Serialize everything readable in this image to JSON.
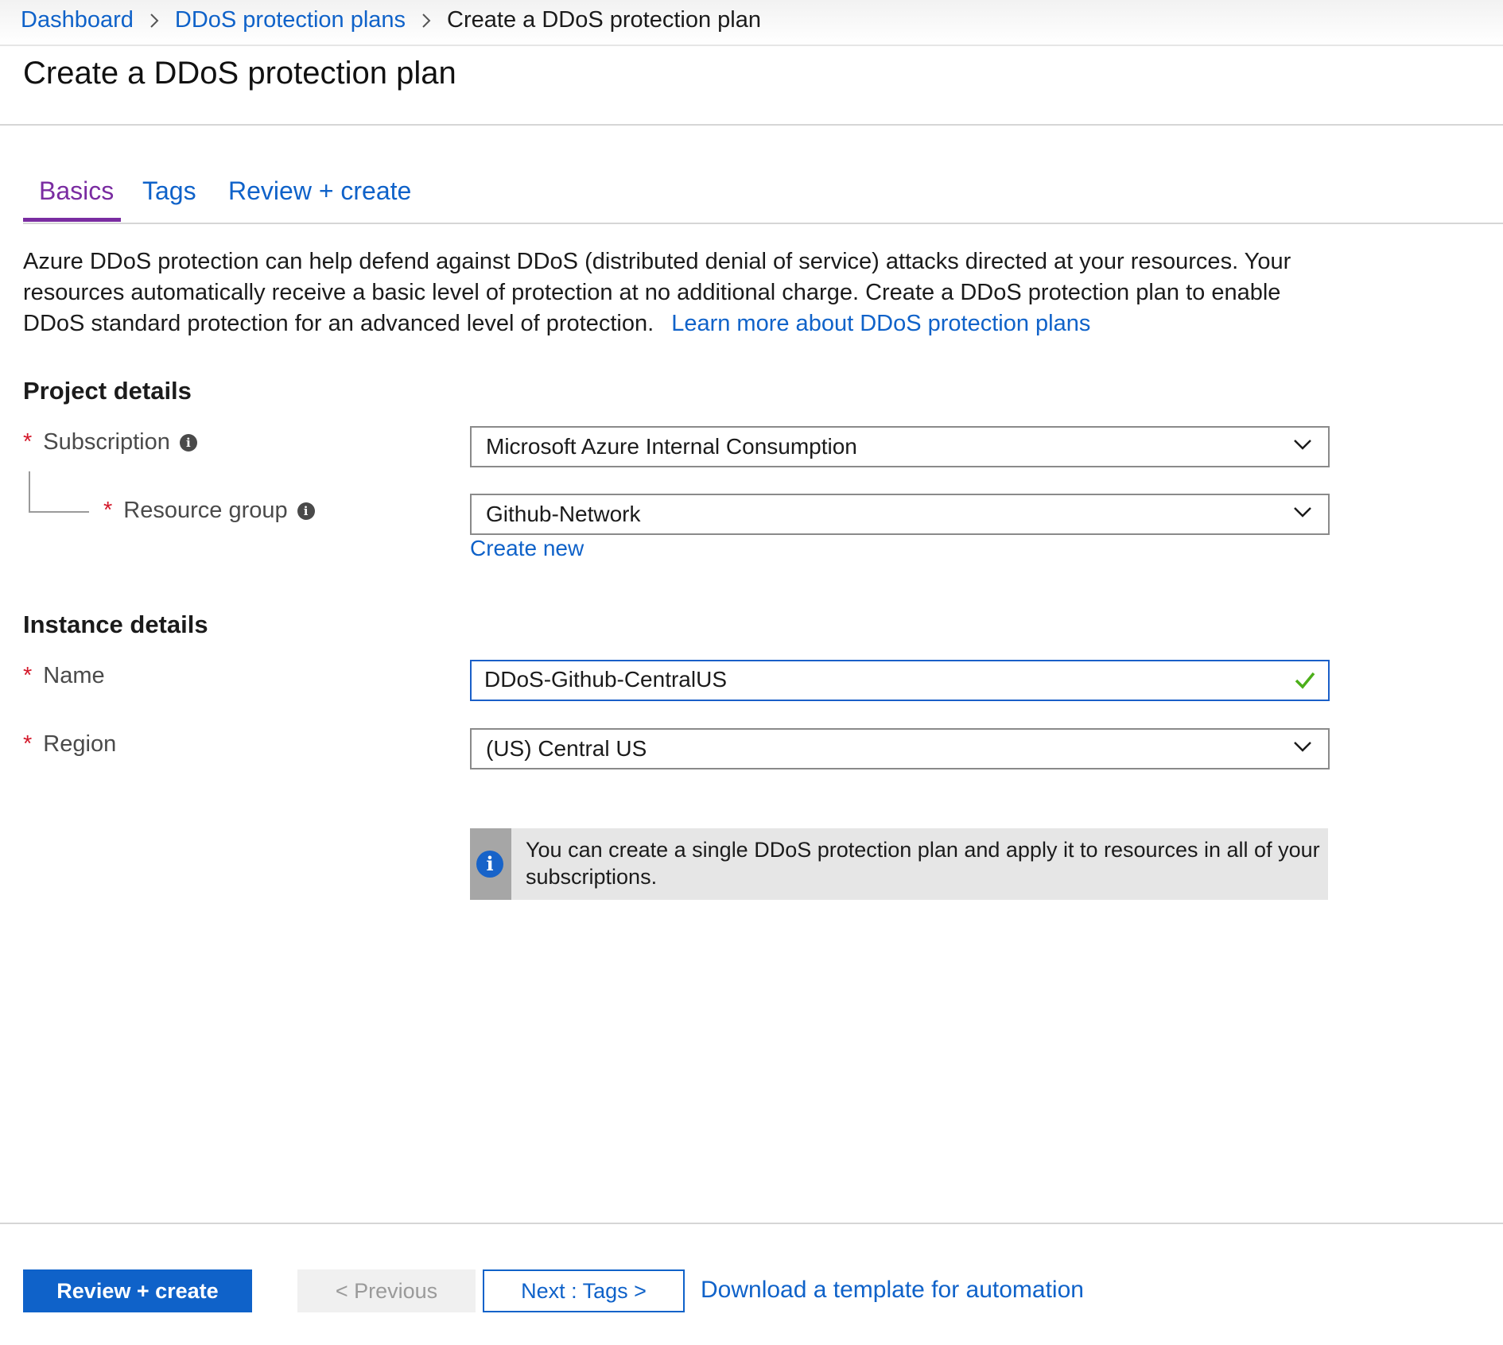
{
  "breadcrumb": {
    "items": [
      "Dashboard",
      "DDoS protection plans"
    ],
    "current": "Create a DDoS protection plan"
  },
  "page": {
    "title": "Create a DDoS protection plan"
  },
  "tabs": [
    {
      "label": "Basics",
      "active": true
    },
    {
      "label": "Tags",
      "active": false
    },
    {
      "label": "Review + create",
      "active": false
    }
  ],
  "intro": {
    "text": "Azure DDoS protection can help defend against DDoS (distributed denial of service) attacks directed at your resources. Your resources automatically receive a basic level of protection at no additional charge. Create a DDoS protection plan to enable DDoS standard protection for an advanced level of protection.",
    "link": "Learn more about DDoS protection plans"
  },
  "project_details": {
    "heading": "Project details",
    "subscription": {
      "label": "Subscription",
      "value": "Microsoft Azure Internal Consumption"
    },
    "resource_group": {
      "label": "Resource group",
      "value": "Github-Network",
      "create_new": "Create new"
    }
  },
  "instance_details": {
    "heading": "Instance details",
    "name": {
      "label": "Name",
      "value": "DDoS-Github-CentralUS"
    },
    "region": {
      "label": "Region",
      "value": "(US) Central US"
    }
  },
  "info_message": "You can create a single DDoS protection plan and apply it to resources in all of your subscriptions.",
  "footer": {
    "review_create": "Review + create",
    "previous": "< Previous",
    "next": "Next : Tags >",
    "download_template": "Download a template for automation"
  },
  "colors": {
    "accent": "#0f62c9",
    "active_tab": "#7a2ca1",
    "required": "#d4192b",
    "valid": "#4caf1a"
  },
  "icons": [
    "chevron-right-icon",
    "info-icon",
    "chevron-down-icon",
    "checkmark-icon"
  ]
}
